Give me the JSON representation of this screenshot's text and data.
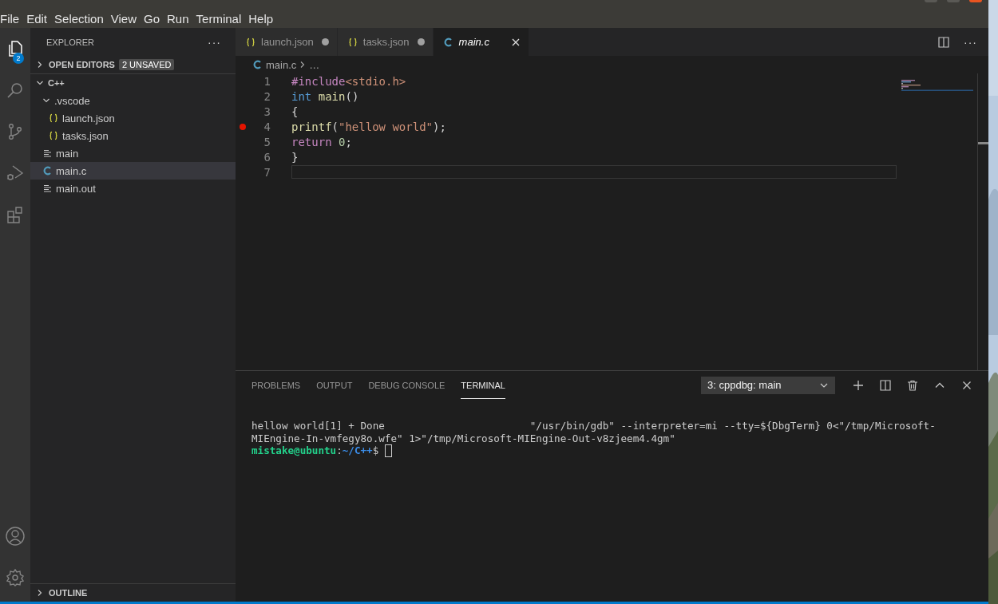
{
  "menu": [
    "File",
    "Edit",
    "Selection",
    "View",
    "Go",
    "Run",
    "Terminal",
    "Help"
  ],
  "activity_bar": {
    "items": [
      {
        "kind": "explorer",
        "selected": true,
        "badge": "2"
      },
      {
        "kind": "search",
        "selected": false
      },
      {
        "kind": "source-control",
        "selected": false
      },
      {
        "kind": "run",
        "selected": false
      },
      {
        "kind": "extensions",
        "selected": false
      }
    ],
    "bottom": [
      {
        "kind": "account"
      },
      {
        "kind": "settings"
      }
    ]
  },
  "sidebar": {
    "title": "EXPLORER",
    "more": "···",
    "open_editors": {
      "label": "OPEN EDITORS",
      "badge": "2 UNSAVED",
      "expanded": false
    },
    "tree": [
      {
        "label": "C++",
        "kind": "root",
        "expanded": true,
        "selected": false,
        "children": [
          {
            "label": ".vscode",
            "kind": "folder",
            "expanded": true,
            "selected": false,
            "children": [
              {
                "label": "launch.json",
                "kind": "json",
                "selected": false
              },
              {
                "label": "tasks.json",
                "kind": "json",
                "selected": false
              }
            ]
          },
          {
            "label": "main",
            "kind": "text",
            "selected": false
          },
          {
            "label": "main.c",
            "kind": "c",
            "selected": true
          },
          {
            "label": "main.out",
            "kind": "text",
            "selected": false
          }
        ]
      }
    ],
    "outline": {
      "label": "OUTLINE",
      "expanded": false
    }
  },
  "tabs": [
    {
      "label": "launch.json",
      "kind": "json",
      "selected": false,
      "modified": true,
      "preview": false
    },
    {
      "label": "tasks.json",
      "kind": "json",
      "selected": false,
      "modified": true,
      "preview": false
    },
    {
      "label": "main.c",
      "kind": "c",
      "selected": true,
      "modified": false,
      "preview": true
    }
  ],
  "breadcrumb": [
    "main.c",
    "…"
  ],
  "code_lines": [
    {
      "number": "1",
      "breakpoint": false,
      "current": false,
      "tokens": [
        {
          "text": "#include",
          "kind": "directive"
        },
        {
          "text": "<stdio.h>",
          "kind": "string"
        }
      ]
    },
    {
      "number": "2",
      "breakpoint": false,
      "current": false,
      "tokens": [
        {
          "text": "int",
          "kind": "keyword"
        },
        {
          "text": " main",
          "kind": "function"
        },
        {
          "text": "()",
          "kind": "plain"
        }
      ]
    },
    {
      "number": "3",
      "breakpoint": false,
      "current": false,
      "tokens": [
        {
          "text": "{",
          "kind": "plain"
        }
      ]
    },
    {
      "number": "4",
      "breakpoint": true,
      "current": false,
      "tokens": [
        {
          "text": "printf",
          "kind": "function"
        },
        {
          "text": "(",
          "kind": "plain"
        },
        {
          "text": "\"hellow world\"",
          "kind": "string"
        },
        {
          "text": ");",
          "kind": "plain"
        }
      ]
    },
    {
      "number": "5",
      "breakpoint": false,
      "current": false,
      "tokens": [
        {
          "text": "return",
          "kind": "control"
        },
        {
          "text": " 0",
          "kind": "number"
        },
        {
          "text": ";",
          "kind": "plain"
        }
      ]
    },
    {
      "number": "6",
      "breakpoint": false,
      "current": false,
      "tokens": [
        {
          "text": "}",
          "kind": "plain"
        }
      ]
    },
    {
      "number": "7",
      "breakpoint": false,
      "current": true
    }
  ],
  "panel": {
    "tabs": [
      {
        "label": "PROBLEMS",
        "selected": false
      },
      {
        "label": "OUTPUT",
        "selected": false
      },
      {
        "label": "DEBUG CONSOLE",
        "selected": false
      },
      {
        "label": "TERMINAL",
        "selected": true
      }
    ],
    "terminal_select": "3: cppdbg: main",
    "terminal_lines": [
      [
        {
          "text": "hellow world[1] + Done                        \"/usr/bin/gdb\" --interpreter=mi --tty=${DbgTerm} 0<\"/tmp/Microsoft-",
          "kind": "plain"
        }
      ],
      [
        {
          "text": "MIEngine-In-vmfegy8o.wfe\" 1>\"/tmp/Microsoft-MIEngine-Out-v8zjeem4.4gm\"",
          "kind": "plain"
        }
      ],
      [
        {
          "text": "mistake@ubuntu",
          "kind": "user"
        },
        {
          "text": ":",
          "kind": "plain"
        },
        {
          "text": "~/C++",
          "kind": "path"
        },
        {
          "text": "$ ",
          "kind": "plain"
        },
        {
          "kind": "cursor"
        }
      ]
    ]
  }
}
